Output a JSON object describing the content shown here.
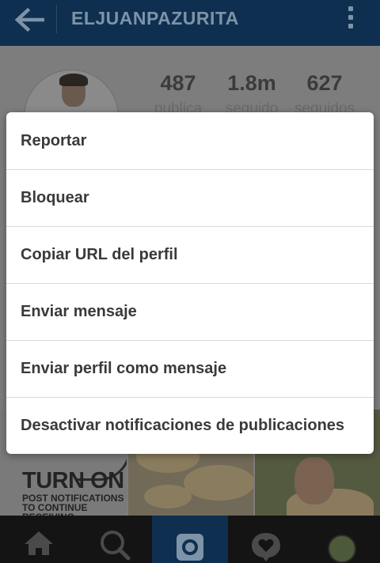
{
  "header": {
    "username": "ELJUANPAZURITA",
    "back_icon": "back-arrow-icon",
    "menu_icon": "kebab-menu-icon"
  },
  "profile": {
    "stats": [
      {
        "value": "487",
        "label": "publica"
      },
      {
        "value": "1.8m",
        "label": "seguido"
      },
      {
        "value": "627",
        "label": "seguidos"
      }
    ]
  },
  "grid": {
    "tile1_title": "TURN ON",
    "tile1_line1": "POST NOTIFICATIONS",
    "tile1_line2": "TO CONTINUE RECEIVING"
  },
  "dialog": {
    "items": [
      "Reportar",
      "Bloquear",
      "Copiar URL del perfil",
      "Enviar mensaje",
      "Enviar perfil como mensaje",
      "Desactivar notificaciones de publicaciones"
    ]
  },
  "bottom_nav": {
    "items": [
      "home-icon",
      "search-icon",
      "camera-icon",
      "activity-heart-icon",
      "profile-avatar"
    ],
    "active": "camera-icon"
  },
  "colors": {
    "topbar": "#0f2f50",
    "overlay_bg": "#7d7d7d",
    "dialog_bg": "#ffffff",
    "dialog_text": "#3a3a3a",
    "divider": "#d9d9d9"
  }
}
